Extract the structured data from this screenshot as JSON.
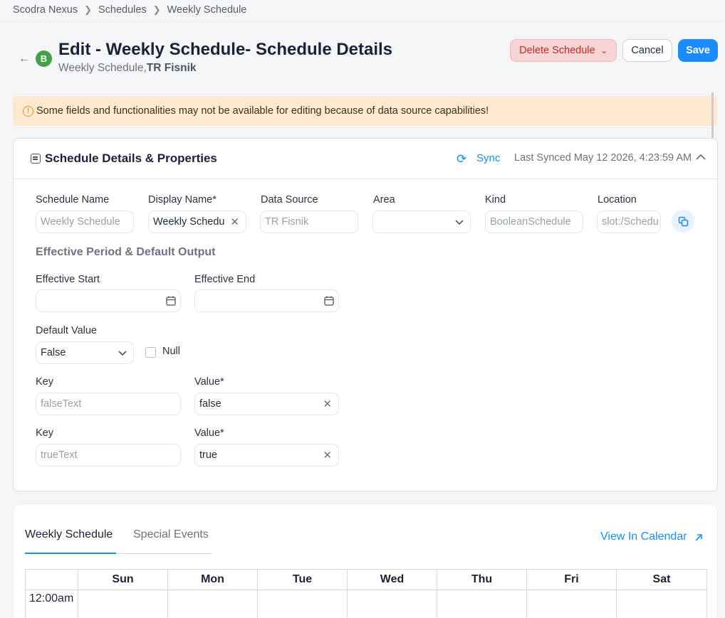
{
  "breadcrumb": {
    "items": [
      "Scodra Nexus",
      "Schedules",
      "Weekly Schedule"
    ]
  },
  "header": {
    "avatar_letter": "B",
    "title": "Edit - Weekly Schedule- Schedule Details",
    "subtitle_plain": "Weekly Schedule,",
    "subtitle_bold": "TR Fisnik",
    "delete_label": "Delete Schedule",
    "cancel_label": "Cancel",
    "save_label": "Save"
  },
  "warning": {
    "text": "Some fields and functionalities may not be available for editing because of data source capabilities!"
  },
  "details": {
    "title": "Schedule Details & Properties",
    "sync_label": "Sync",
    "last_synced": "Last Synced May 12 2026, 4:23:59 AM",
    "fields": {
      "schedule_name": {
        "label": "Schedule Name",
        "value": "Weekly Schedule"
      },
      "display_name": {
        "label": "Display Name*",
        "value": "Weekly Schedu"
      },
      "data_source": {
        "label": "Data Source",
        "value": "TR Fisnik"
      },
      "area": {
        "label": "Area",
        "value": ""
      },
      "kind": {
        "label": "Kind",
        "value": "BooleanSchedule"
      },
      "location": {
        "label": "Location",
        "value": "slot:/Schedu"
      }
    },
    "section_title": "Effective Period & Default Output",
    "effective_start": {
      "label": "Effective Start",
      "value": ""
    },
    "effective_end": {
      "label": "Effective End",
      "value": ""
    },
    "default_value": {
      "label": "Default Value",
      "value": "False",
      "null_label": "Null"
    },
    "kv_rows": [
      {
        "key_label": "Key",
        "key_value": "falseText",
        "value_label": "Value*",
        "value": "false"
      },
      {
        "key_label": "Key",
        "key_value": "trueText",
        "value_label": "Value*",
        "value": "true"
      }
    ]
  },
  "schedule_tabs": {
    "tabs": [
      "Weekly Schedule",
      "Special Events"
    ],
    "active": "Weekly Schedule",
    "view_in_calendar": "View In Calendar"
  },
  "calendar": {
    "days": [
      "Sun",
      "Mon",
      "Tue",
      "Wed",
      "Thu",
      "Fri",
      "Sat"
    ],
    "times": [
      "12:00am"
    ]
  },
  "colors": {
    "accent": "#1a8cff",
    "danger": "#c62828",
    "warning_bg": "#fde9cf",
    "avatar": "#43a047"
  }
}
